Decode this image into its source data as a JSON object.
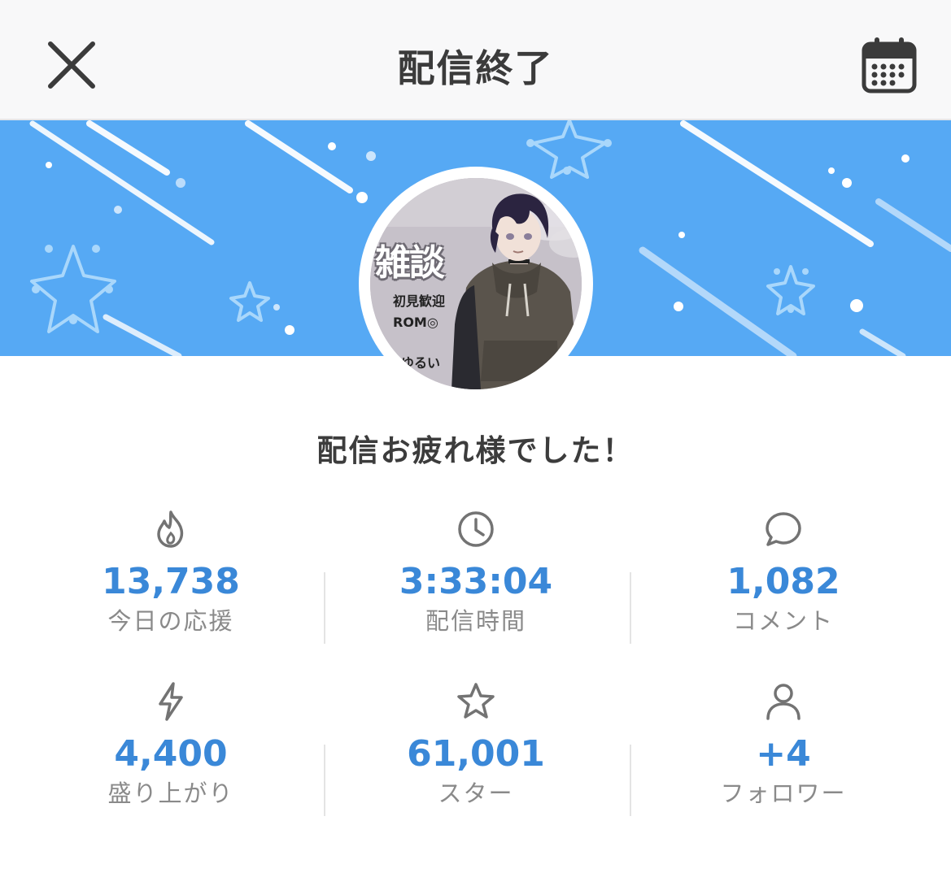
{
  "header": {
    "title": "配信終了",
    "close_icon": "close-icon",
    "calendar_icon": "calendar-icon"
  },
  "banner": {
    "color": "#56a9f4"
  },
  "thumbnail": {
    "title": "雑談",
    "line1": "初見歓迎",
    "line2": "ROM◎",
    "line3": "ゆるい"
  },
  "message": "配信お疲れ様でした！",
  "stats": [
    {
      "icon": "flame-icon",
      "value": "13,738",
      "label": "今日の応援"
    },
    {
      "icon": "clock-icon",
      "value": "3:33:04",
      "label": "配信時間"
    },
    {
      "icon": "comment-icon",
      "value": "1,082",
      "label": "コメント"
    },
    {
      "icon": "lightning-icon",
      "value": "4,400",
      "label": "盛り上がり"
    },
    {
      "icon": "star-icon",
      "value": "61,001",
      "label": "スター"
    },
    {
      "icon": "user-icon",
      "value": "+4",
      "label": "フォロワー"
    }
  ],
  "colors": {
    "accent": "#3a88d8",
    "label": "#8a8a8a",
    "header_bg": "#f8f8f9"
  }
}
